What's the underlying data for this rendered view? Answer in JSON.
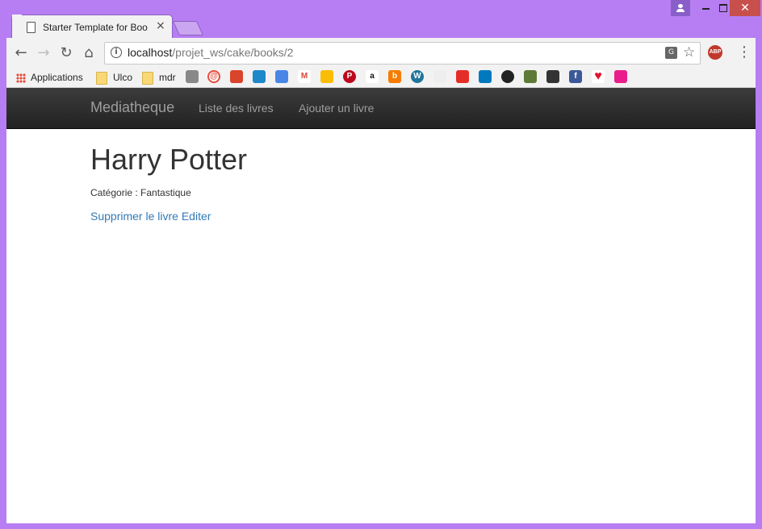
{
  "browser": {
    "tab_title": "Starter Template for Bootstrap",
    "close_glyph": "×",
    "window_close_glyph": "✕",
    "url_host": "localhost",
    "url_path": "/projet_ws/cake/books/2",
    "bookmarks": {
      "apps_label": "Applications",
      "folder1": "Ulco",
      "folder2": "mdr"
    },
    "icons": [
      "back-icon",
      "forward-icon",
      "reload-icon",
      "home-icon",
      "info-icon",
      "translate-icon",
      "star-icon",
      "adblock-icon",
      "menu-icon"
    ],
    "accent_color": "#b77df2"
  },
  "navbar": {
    "brand": "Mediatheque",
    "links": [
      "Liste des livres",
      "Ajouter un livre"
    ]
  },
  "book": {
    "title": "Harry Potter",
    "category_line": "Catégorie : Fantastique",
    "delete_label": "Supprimer le livre",
    "edit_label": "Editer"
  },
  "colors": {
    "link": "#337ab7",
    "navbar_bg": "#222222",
    "navbar_text": "#9d9d9d"
  }
}
